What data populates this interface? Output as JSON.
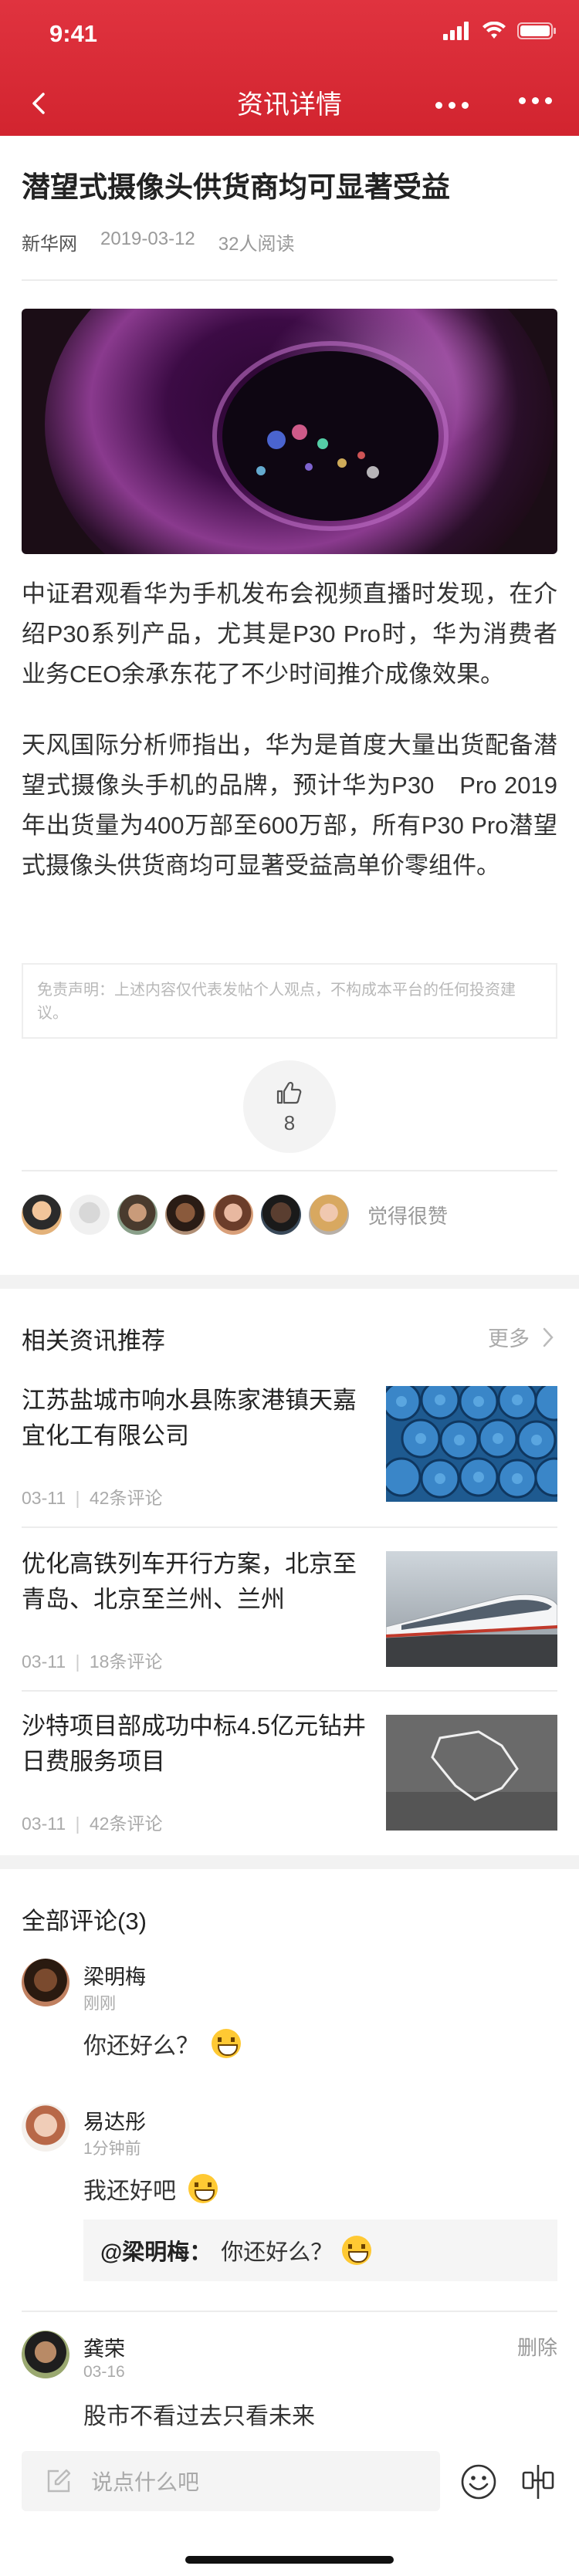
{
  "status_bar": {
    "time": "9:41"
  },
  "nav": {
    "title": "资讯详情"
  },
  "article": {
    "title": "潜望式摄像头供货商均可显著受益",
    "source": "新华网",
    "date": "2019-03-12",
    "reads": "32人阅读",
    "paragraphs": [
      "中证君观看华为手机发布会视频直播时发现，在介绍P30系列产品，尤其是P30 Pro时，华为消费者业务CEO余承东花了不少时间推介成像效果。",
      "天风国际分析师指出，华为是首度大量出货配备潜望式摄像头手机的品牌，预计华为P30　Pro 2019年出货量为400万部至600万部，所有P30 Pro潜望式摄像头供货商均可显著受益高单价零组件。"
    ],
    "disclaimer": "免责声明：上述内容仅代表发帖个人观点，不构成本平台的任何投资建议。",
    "like_count": "8",
    "likers_text": "觉得很赞"
  },
  "related": {
    "title": "相关资讯推荐",
    "more_label": "更多",
    "items": [
      {
        "title": "江苏盐城市响水县陈家港镇天嘉宜化工有限公司",
        "date": "03-11",
        "comments": "42条评论"
      },
      {
        "title": "优化高铁列车开行方案，北京至青岛、北京至兰州、兰州",
        "date": "03-11",
        "comments": "18条评论"
      },
      {
        "title": "沙特项目部成功中标4.5亿元钻井日费服务项目",
        "date": "03-11",
        "comments": "42条评论"
      }
    ]
  },
  "comments": {
    "title": "全部评论(3)",
    "items": [
      {
        "name": "梁明梅",
        "time": "刚刚",
        "text": "你还好么？"
      },
      {
        "name": "易达彤",
        "time": "1分钟前",
        "text": "我还好吧",
        "quote": {
          "author": "@梁明梅：",
          "text": "你还好么？"
        }
      },
      {
        "name": "龚荣",
        "time": "03-16",
        "text": "股市不看过去只看未来",
        "delete_label": "删除"
      }
    ]
  },
  "bottom_bar": {
    "placeholder": "说点什么吧"
  },
  "colors": {
    "brand_red": "#d8262f"
  }
}
